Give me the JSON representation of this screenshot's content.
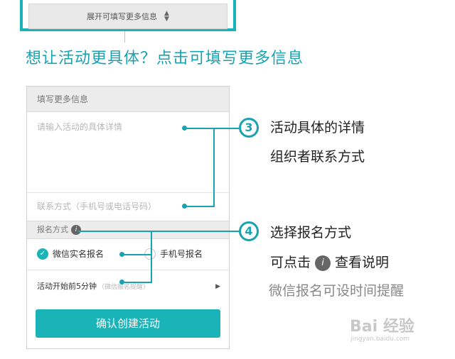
{
  "top": {
    "expand_label": "展开可填写更多信息",
    "expand_chevron": "⬍"
  },
  "headline": "想让活动更具体？点击可填写更多信息",
  "form": {
    "section_title": "填写更多信息",
    "detail_placeholder": "请输入活动的具体详情",
    "contact_placeholder": "联系方式（手机号或电话号码）",
    "method_title": "报名方式",
    "method_info_icon": "i",
    "options": {
      "wechat": "微信实名报名",
      "phone": "手机号报名",
      "selected": "微信实名报名"
    },
    "reminder_label": "活动开始前5分钟",
    "reminder_hint": "（微信报名提醒）",
    "confirm_label": "确认创建活动"
  },
  "annotations": {
    "badge3": "3",
    "line3a": "活动具体的详情",
    "line3b": "组织者联系方式",
    "badge4": "4",
    "line4a": "选择报名方式",
    "line4b_pre": "可点击",
    "line4b_icon": "i",
    "line4b_post": "查看说明",
    "line4c": "微信报名可设时间提醒"
  },
  "watermark": {
    "brand": "Bai  经验",
    "url": "jingyan.baidu.com"
  },
  "colors": {
    "accent": "#19b3b8",
    "annotation": "#19a2b1"
  }
}
